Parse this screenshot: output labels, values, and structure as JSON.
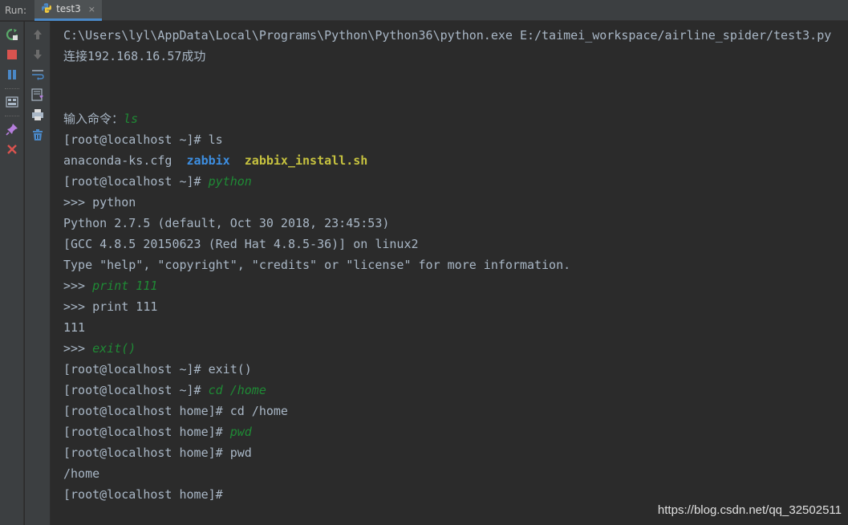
{
  "run_panel": {
    "label": "Run:",
    "tab": {
      "title": "test3",
      "close": "×"
    }
  },
  "toolbar_left": [
    {
      "name": "rerun-icon",
      "glyph": "↻",
      "color": "#59a869"
    },
    {
      "name": "stop-icon",
      "glyph": "■",
      "color": "#d9534f"
    },
    {
      "name": "pause-icon",
      "glyph": "❚❚",
      "color": "#4a88c7"
    },
    {
      "name": "layout-icon",
      "glyph": "▤",
      "color": "#a9b7c6"
    },
    {
      "name": "pin-icon",
      "glyph": "📌",
      "color": "#b57edc"
    },
    {
      "name": "close-icon",
      "glyph": "✕",
      "color": "#d9534f"
    }
  ],
  "toolbar_right": [
    {
      "name": "up-arrow-icon",
      "glyph": "↑",
      "color": "#777777"
    },
    {
      "name": "down-arrow-icon",
      "glyph": "↓",
      "color": "#777777"
    },
    {
      "name": "soft-wrap-icon",
      "glyph": "⇆",
      "color": "#a9b7c6"
    },
    {
      "name": "scroll-to-end-icon",
      "glyph": "⤓",
      "color": "#a9b7c6"
    },
    {
      "name": "print-icon",
      "glyph": "⎙",
      "color": "#a9b7c6"
    },
    {
      "name": "trash-icon",
      "glyph": "🗑",
      "color": "#4a88c7"
    }
  ],
  "console": {
    "l01": "C:\\Users\\lyl\\AppData\\Local\\Programs\\Python\\Python36\\python.exe E:/taimei_workspace/airline_spider/test3.py",
    "l02": "连接192.168.16.57成功",
    "l05_prompt": "输入命令：",
    "l05_input": "ls",
    "l06": "[root@localhost ~]# ls",
    "l07_a": "anaconda-ks.cfg  ",
    "l07_b": "zabbix",
    "l07_c": "  ",
    "l07_d": "zabbix_install.sh",
    "l08_prompt": "[root@localhost ~]# ",
    "l08_input": "python",
    "l09": ">>> python",
    "l10": "Python 2.7.5 (default, Oct 30 2018, 23:45:53)",
    "l11": "[GCC 4.8.5 20150623 (Red Hat 4.8.5-36)] on linux2",
    "l12": "Type \"help\", \"copyright\", \"credits\" or \"license\" for more information.",
    "l13_prompt": ">>> ",
    "l13_input": "print 111",
    "l14": ">>> print 111",
    "l15": "111",
    "l16_prompt": ">>> ",
    "l16_input": "exit()",
    "l17": "[root@localhost ~]# exit()",
    "l18_prompt": "[root@localhost ~]# ",
    "l18_input": "cd /home",
    "l19": "[root@localhost home]# cd /home",
    "l20_prompt": "[root@localhost home]# ",
    "l20_input": "pwd",
    "l21": "[root@localhost home]# pwd",
    "l22": "/home",
    "l23": "[root@localhost home]#"
  },
  "watermark": "https://blog.csdn.net/qq_32502511"
}
